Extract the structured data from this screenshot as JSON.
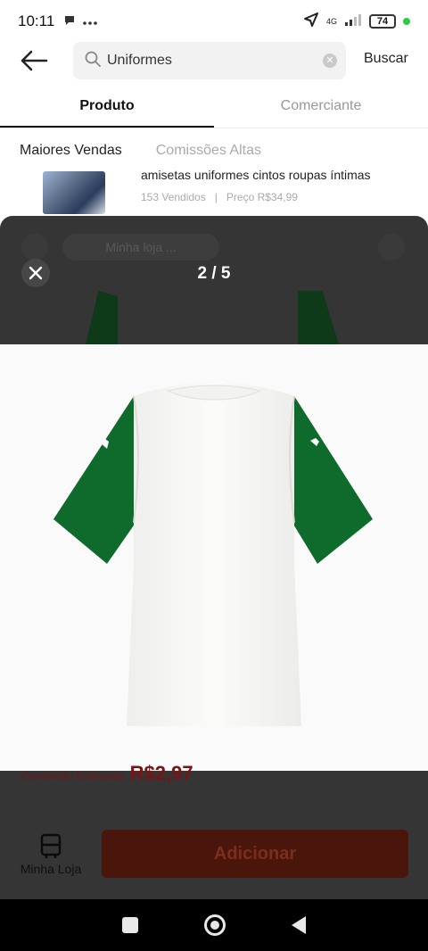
{
  "status": {
    "time": "10:11",
    "network": "4G",
    "battery": "74"
  },
  "search": {
    "query": "Uniformes",
    "submit_label": "Buscar"
  },
  "tabs": [
    {
      "label": "Produto"
    },
    {
      "label": "Comerciante"
    }
  ],
  "subtabs": [
    {
      "label": "Maiores Vendas"
    },
    {
      "label": "Comissões Altas"
    }
  ],
  "product": {
    "title": "amisetas uniformes cintos roupas íntimas",
    "sold": "153 Vendidos",
    "separator": "|",
    "price": "Preço R$34,99"
  },
  "viewer": {
    "counter": "2 / 5",
    "background_pill": "Minha loja ...",
    "faded_price_label": "Comissão Estimada",
    "faded_price_value": "R$2,97"
  },
  "bottom": {
    "store_label": "Minha Loja",
    "add_label": "Adicionar"
  },
  "colors": {
    "shirt_body": "#f7f7f5",
    "shirt_sleeve": "#0e6b2c",
    "accent": "#e8431f"
  }
}
